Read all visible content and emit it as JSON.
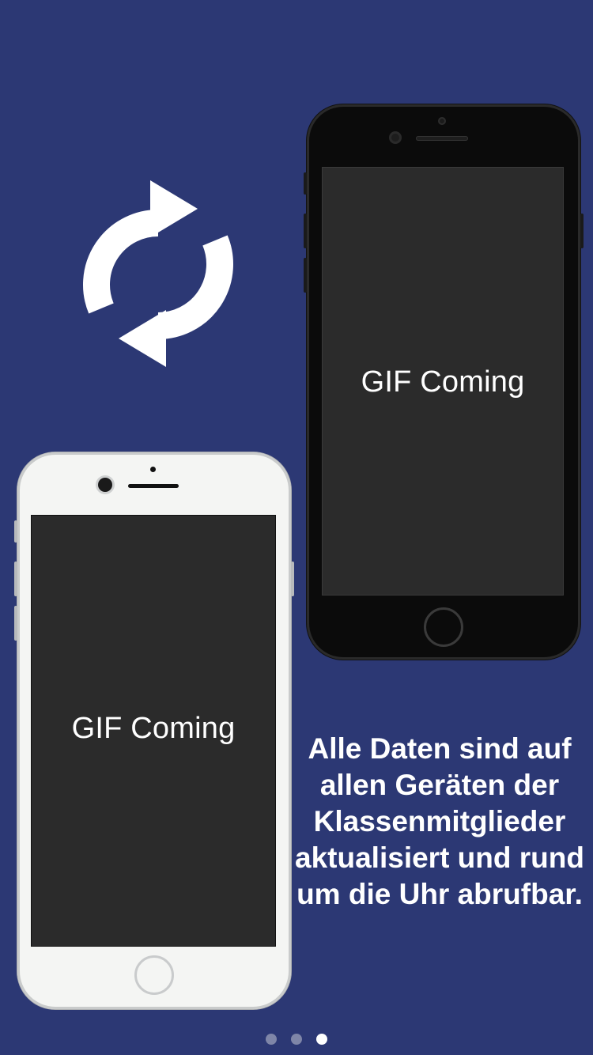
{
  "onboarding": {
    "page_index": 3,
    "page_count": 3,
    "sync_icon": "refresh-sync-icon",
    "phone_black": {
      "screen_text": "GIF Coming"
    },
    "phone_white": {
      "screen_text": "GIF Coming"
    },
    "caption": "Alle Daten sind auf allen Geräten der Klassenmitglieder aktualisiert und rund um die Uhr abrufbar.",
    "colors": {
      "background": "#2c3874",
      "text": "#ffffff",
      "dot_inactive": "#7f86a8",
      "dot_active": "#ffffff"
    }
  }
}
